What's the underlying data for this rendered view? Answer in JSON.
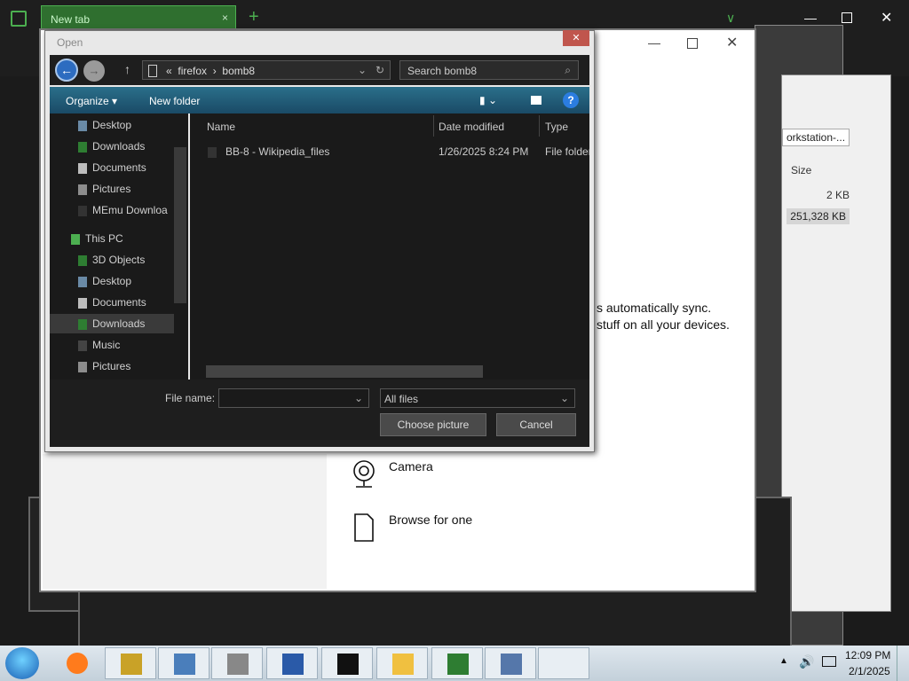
{
  "browser": {
    "tab_label": "New tab",
    "tab_close": "×",
    "newtab": "+",
    "close": "✕",
    "minimize": "—",
    "chevron": "∨"
  },
  "bg_explorer": {
    "address_fragment": "orkstation-...",
    "size_header": "Size",
    "row1_size": "2 KB",
    "row2_size": "251,328 KB"
  },
  "settings": {
    "sync_line1": "s automatically sync.",
    "sync_line2": "stuff on all your devices.",
    "camera_label": "Camera",
    "browse_label": "Browse for one"
  },
  "dialog": {
    "title": "Open",
    "close": "✕",
    "address": {
      "prefix": "«",
      "crumbs": [
        "firefox",
        "bomb8"
      ],
      "separator": "›"
    },
    "search_placeholder": "Search bomb8",
    "toolbar": {
      "organize": "Organize ▾",
      "new_folder": "New folder",
      "help": "?"
    },
    "nav": [
      {
        "label": "Desktop",
        "icon": "desktop-icon",
        "color": "#6a8aa6"
      },
      {
        "label": "Downloads",
        "icon": "downloads-icon",
        "color": "#2e7d32"
      },
      {
        "label": "Documents",
        "icon": "documents-icon",
        "color": "#bdbdbd"
      },
      {
        "label": "Pictures",
        "icon": "pictures-icon",
        "color": "#8d8d8d"
      },
      {
        "label": "MEmu Downloa",
        "icon": "folder-icon",
        "color": "#333333"
      },
      {
        "label": "This PC",
        "icon": "computer-icon",
        "color": "#4caf50"
      },
      {
        "label": "3D Objects",
        "icon": "3d-objects-icon",
        "color": "#2e7d32"
      },
      {
        "label": "Desktop",
        "icon": "desktop-icon",
        "color": "#6a8aa6"
      },
      {
        "label": "Documents",
        "icon": "documents-icon",
        "color": "#bdbdbd"
      },
      {
        "label": "Downloads",
        "icon": "downloads-icon",
        "color": "#2e7d32"
      },
      {
        "label": "Music",
        "icon": "music-icon",
        "color": "#444444"
      },
      {
        "label": "Pictures",
        "icon": "pictures-icon",
        "color": "#8d8d8d"
      }
    ],
    "columns": [
      "Name",
      "Date modified",
      "Type"
    ],
    "files": [
      {
        "name": "BB-8 - Wikipedia_files",
        "date": "1/26/2025 8:24 PM",
        "type": "File folder"
      }
    ],
    "file_name_label": "File name:",
    "file_name_value": "",
    "filter": "All files",
    "choose_button": "Choose picture",
    "cancel_button": "Cancel"
  },
  "taskbar": {
    "time": "12:09 PM",
    "date": "2/1/2025",
    "apps": [
      "firefox-icon",
      "bee-app-icon",
      "remote-desktop-icon",
      "settings-gear-icon",
      "powershell-icon",
      "terminal-icon",
      "file-explorer-icon",
      "network-tool-icon",
      "network-setup-icon",
      "blank-window"
    ]
  },
  "colors": {
    "accent": "#2b7de0",
    "toolbar_top": "#2a6f8a",
    "browser_green": "#4caf50",
    "dialog_dark": "#1a1a1a"
  }
}
